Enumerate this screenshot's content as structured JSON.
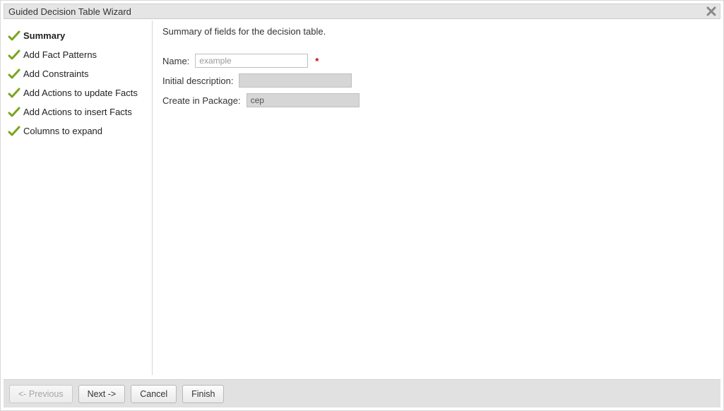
{
  "title": "Guided Decision Table Wizard",
  "sidebar": {
    "items": [
      {
        "label": "Summary",
        "active": true
      },
      {
        "label": "Add Fact Patterns",
        "active": false
      },
      {
        "label": "Add Constraints",
        "active": false
      },
      {
        "label": "Add Actions to update Facts",
        "active": false
      },
      {
        "label": "Add Actions to insert Facts",
        "active": false
      },
      {
        "label": "Columns to expand",
        "active": false
      }
    ]
  },
  "content": {
    "heading": "Summary of fields for the decision table.",
    "name_label": "Name:",
    "name_placeholder": "example",
    "name_value": "",
    "required_mark": "*",
    "desc_label": "Initial description:",
    "desc_value": "",
    "pkg_label": "Create in Package:",
    "pkg_value": "cep"
  },
  "footer": {
    "previous": "<- Previous",
    "next": "Next ->",
    "cancel": "Cancel",
    "finish": "Finish"
  }
}
